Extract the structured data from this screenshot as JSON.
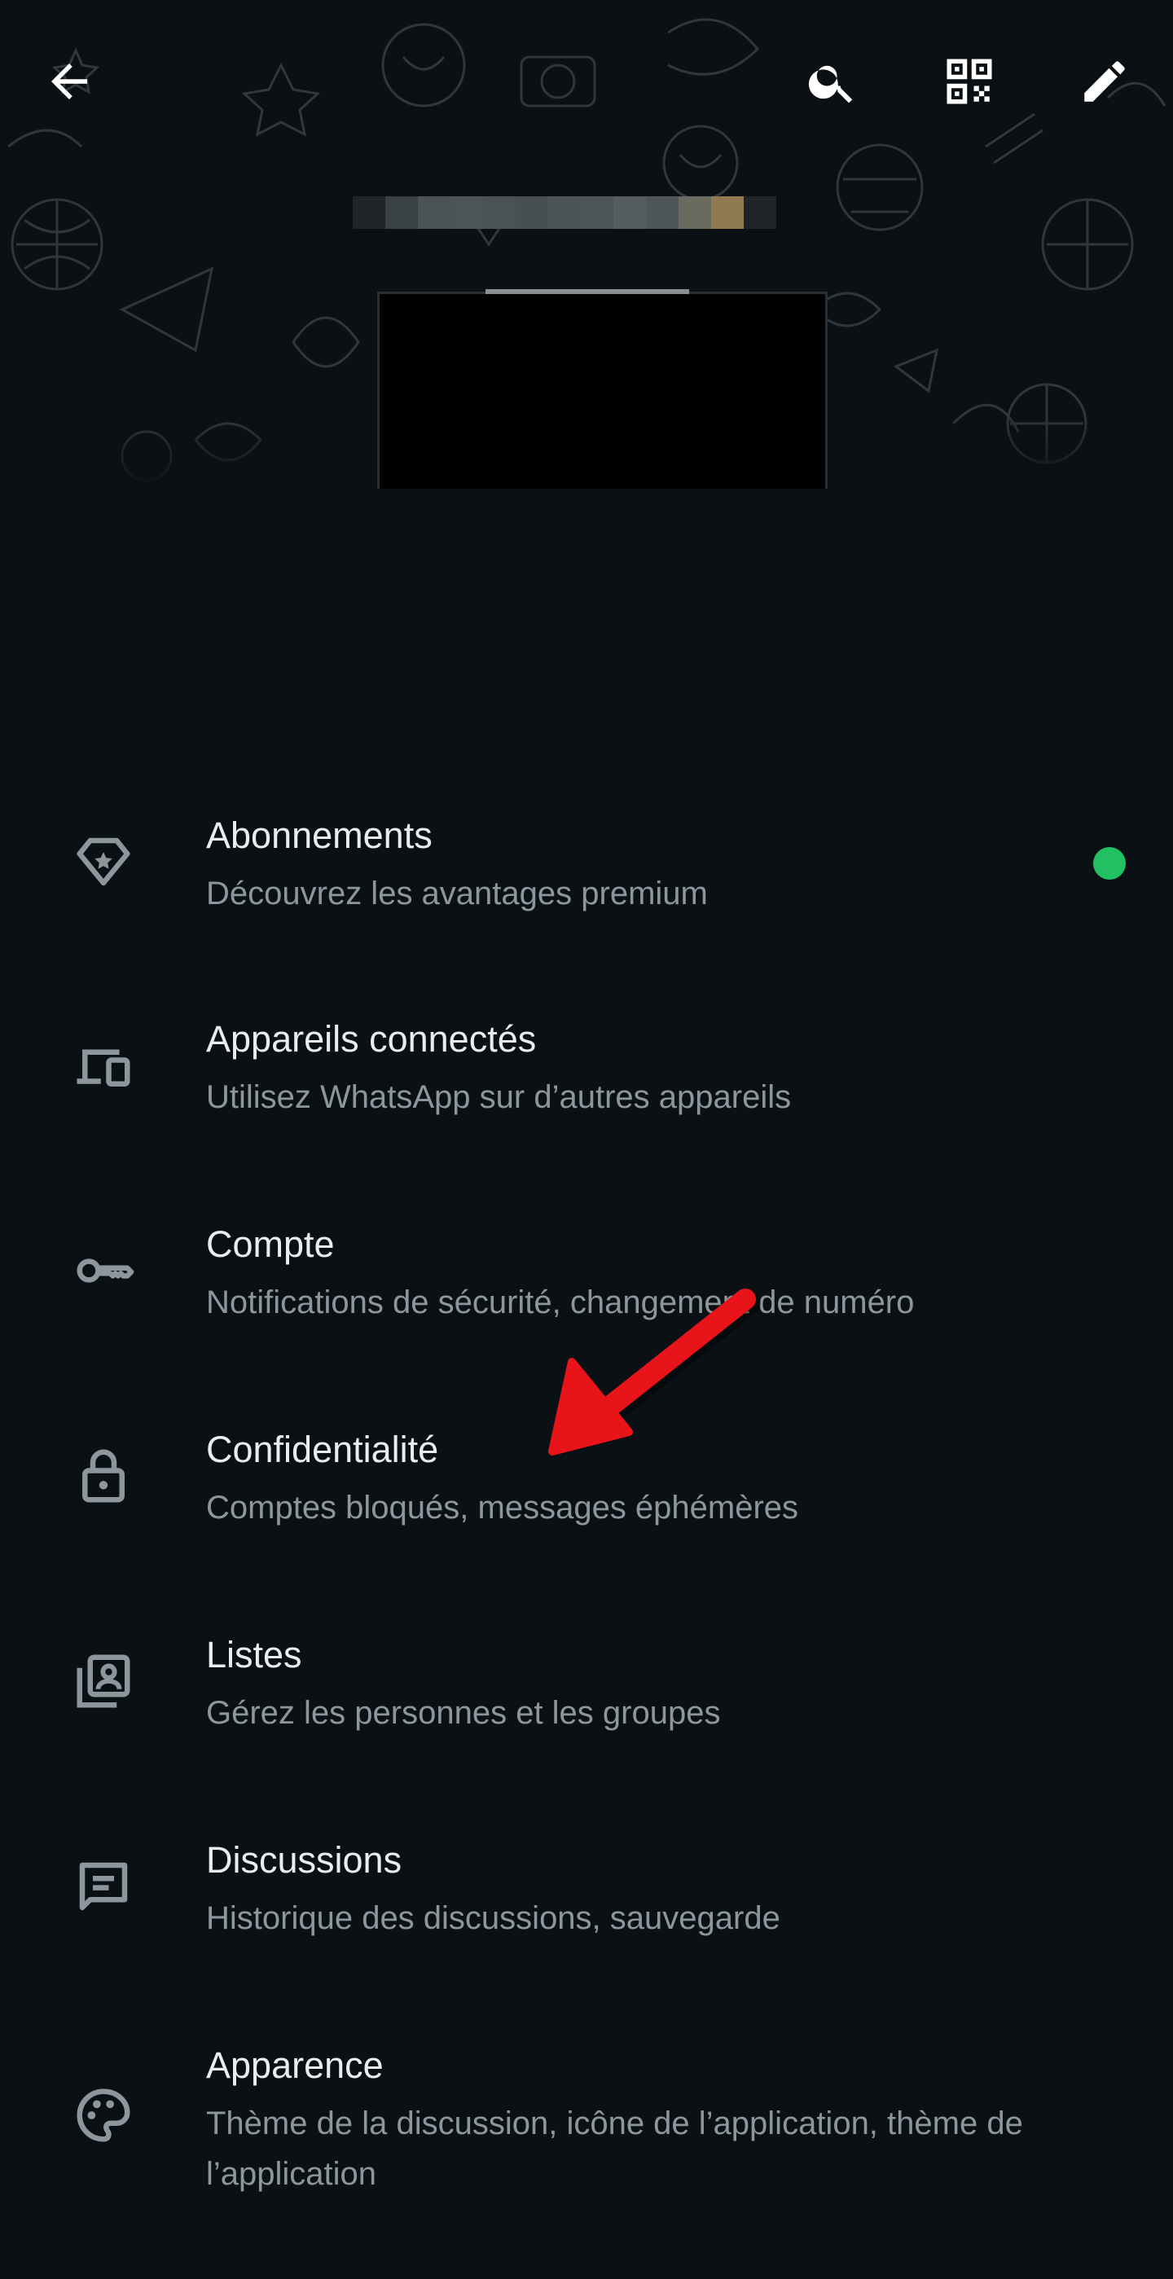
{
  "profile": {
    "name": "",
    "status": ""
  },
  "colors": {
    "background": "#0b1014",
    "primary_text": "#e9edef",
    "secondary_text": "#8c979d",
    "accent_dot": "#21c063",
    "annotation_arrow": "#e8141a"
  },
  "header_icons": [
    "back-arrow-icon",
    "search-icon",
    "qr-code-icon",
    "edit-pencil-icon"
  ],
  "menu": {
    "items": [
      {
        "icon": "premium-badge-icon",
        "title": "Abonnements",
        "subtitle": "Découvrez les avantages premium"
      },
      {
        "icon": "linked-devices-icon",
        "title": "Appareils connectés",
        "subtitle": "Utilisez WhatsApp sur d’autres appareils"
      },
      {
        "icon": "key-icon",
        "title": "Compte",
        "subtitle": "Notifications de sécurité, changement de numéro"
      },
      {
        "icon": "lock-icon",
        "title": "Confidentialité",
        "subtitle": "Comptes bloqués, messages éphémères"
      },
      {
        "icon": "contact-list-icon",
        "title": "Listes",
        "subtitle": "Gérez les personnes et les groupes"
      },
      {
        "icon": "chat-icon",
        "title": "Discussions",
        "subtitle": "Historique des discussions, sauvegarde"
      },
      {
        "icon": "palette-icon",
        "title": "Apparence",
        "subtitle": "Thème de la discussion, icône de l’application, thème de l’application"
      }
    ]
  }
}
